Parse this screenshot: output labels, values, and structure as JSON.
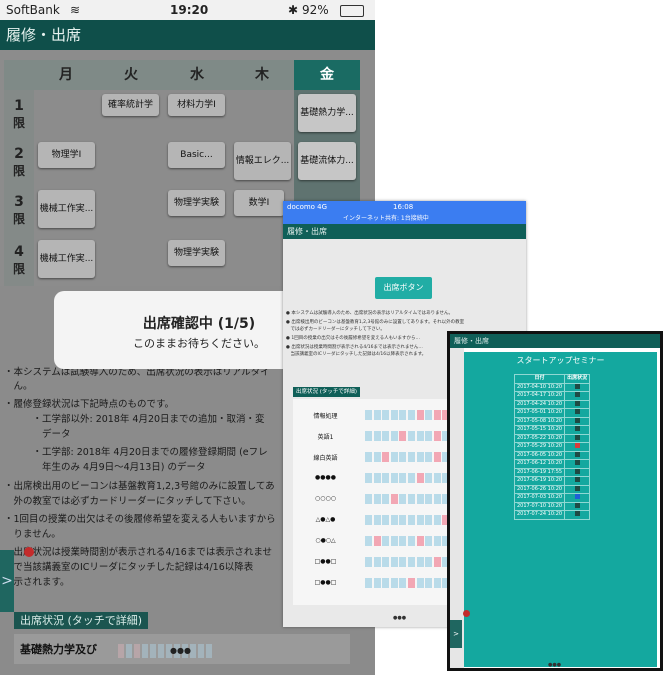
{
  "phone1": {
    "status": {
      "carrier": "SoftBank",
      "time": "19:20",
      "battery": "92%"
    },
    "header_title": "履修・出席",
    "days": [
      "月",
      "火",
      "水",
      "木",
      "金"
    ],
    "periods": [
      {
        "num": "1",
        "label": "限"
      },
      {
        "num": "2",
        "label": "限"
      },
      {
        "num": "3",
        "label": "限"
      },
      {
        "num": "4",
        "label": "限"
      }
    ],
    "courses": {
      "p1_tue": "確率統計学",
      "p1_wed": "材料力学I",
      "p1_fri": "基礎熱力学...",
      "p2_mon": "物理学I",
      "p2_wed": "Basic...",
      "p2_thu": "情報エレク...",
      "p2_fri": "基礎流体力...",
      "p3_mon": "機械工作実...",
      "p3_wed": "物理学実験",
      "p3_thu": "数学I",
      "p4_mon": "機械工作実...",
      "p4_wed": "物理学実験"
    },
    "popup": {
      "title": "出席確認中 (1/5)",
      "subtitle": "このままお待ちください。"
    },
    "notes": [
      "・本システムは試験導入のため、出席状況の表示はリアルタイ",
      "　ん。",
      "・履修登録状況は下記時点のものです。",
      "　　　・工学部以外: 2018年 4月20日までの追加・取消・変",
      "　　　　データ",
      "　　　・工学部: 2018年 4月20日までの履修登録期間 (eフレ",
      "　　　　年生のみ 4月9日～4月13日) のデータ",
      "・出席検出用のビーコンは基盤教育1,2,3号館のみに設置してあ",
      "　外の教室では必ずカードリーダーにタッチして下さい。",
      "・1回目の授業の出欠はその後履修希望を変える人もいますから",
      "　りません。",
      "・出席状況は授業時間割が表示される4/16までは表示されませ",
      "　で当該講義室のICリーダにタッチした記録は4/16以降表",
      "　示されます。"
    ],
    "section_label": "出席状況 (タッチで詳細)",
    "course_row": "基礎熱力学及び",
    "side_tab": ">"
  },
  "phone2": {
    "status": {
      "carrier": "docomo 4G",
      "time": "16:08",
      "battery": "",
      "sub": "インターネット共有: 1台接続中"
    },
    "header_title": "履修・出席",
    "attend_button": "出席ボタン",
    "notes": [
      "● 本システムは試験導入のため、出席状況の表示はリアルタイムではありません。",
      "● 出席検出用のビーコンは基盤教育1,2,3号館のみに設置してあります。それ以外の教室",
      "　では必ずカードリーダーにタッチして下さい。",
      "● 1回目の授業の出欠はその後履修希望を変える人もいますから…",
      "● 出席状況は授業時間割が表示される4/16までは表示されません…",
      "　当該講義室のICリーダにタッチした記録は4/16以降表示されます。"
    ],
    "section_label": "出席状況 (タッチで詳細)",
    "rows": [
      "情報処理",
      "英語1",
      "線白英語",
      "●●●●",
      "○○○○",
      "△●△●",
      "○●○△",
      "□●●□",
      "□●●□"
    ]
  },
  "phone3": {
    "header_title": "履修・出席",
    "seminar_title": "スタートアップセミナー",
    "col_date": "日付",
    "col_status": "出席状況",
    "rows": [
      {
        "date": "2017-04-10 10:20",
        "status": "present"
      },
      {
        "date": "2017-04-17 10:20",
        "status": "present"
      },
      {
        "date": "2017-04-24 10:20",
        "status": "present"
      },
      {
        "date": "2017-05-01 10:20",
        "status": "present"
      },
      {
        "date": "2017-05-08 10:20",
        "status": "present"
      },
      {
        "date": "2017-05-15 10:20",
        "status": "present"
      },
      {
        "date": "2017-05-22 10:20",
        "status": "present"
      },
      {
        "date": "2017-05-29 10:20",
        "status": "absent"
      },
      {
        "date": "2017-06-05 10:20",
        "status": "present"
      },
      {
        "date": "2017-06-12 10:20",
        "status": "present"
      },
      {
        "date": "2017-06-19 17:55",
        "status": "present"
      },
      {
        "date": "2017-06-19 10:20",
        "status": "present"
      },
      {
        "date": "2017-06-26 10:20",
        "status": "present"
      },
      {
        "date": "2017-07-03 10:20",
        "status": "blue"
      },
      {
        "date": "2017-07-10 10:20",
        "status": "present"
      },
      {
        "date": "2017-07-24 10:20",
        "status": "present"
      }
    ],
    "side_tab": ">",
    "colors": {
      "teal": "#14a89f",
      "present": "#1e4a44",
      "absent": "#d83c3c",
      "blue": "#1f5fd6"
    }
  }
}
